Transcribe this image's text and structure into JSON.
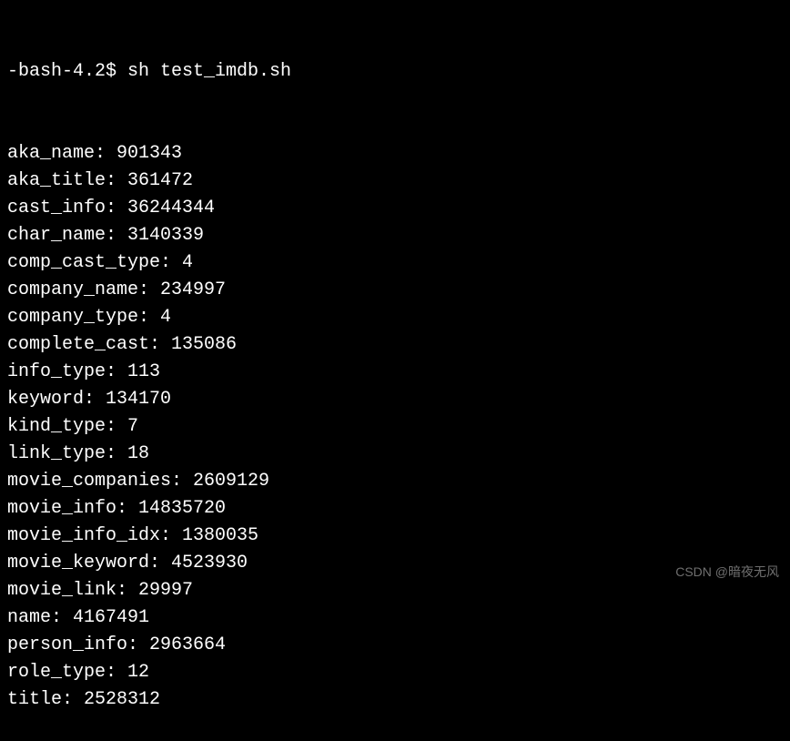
{
  "prompt": {
    "shell": "-bash-4.2$ ",
    "command": "sh test_imdb.sh"
  },
  "output_lines": [
    {
      "key": "aka_name",
      "value": "901343"
    },
    {
      "key": "aka_title",
      "value": "361472"
    },
    {
      "key": "cast_info",
      "value": "36244344"
    },
    {
      "key": "char_name",
      "value": "3140339"
    },
    {
      "key": "comp_cast_type",
      "value": "4"
    },
    {
      "key": "company_name",
      "value": "234997"
    },
    {
      "key": "company_type",
      "value": "4"
    },
    {
      "key": "complete_cast",
      "value": "135086"
    },
    {
      "key": "info_type",
      "value": "113"
    },
    {
      "key": "keyword",
      "value": "134170"
    },
    {
      "key": "kind_type",
      "value": "7"
    },
    {
      "key": "link_type",
      "value": "18"
    },
    {
      "key": "movie_companies",
      "value": "2609129"
    },
    {
      "key": "movie_info",
      "value": "14835720"
    },
    {
      "key": "movie_info_idx",
      "value": "1380035"
    },
    {
      "key": "movie_keyword",
      "value": "4523930"
    },
    {
      "key": "movie_link",
      "value": "29997"
    },
    {
      "key": "name",
      "value": "4167491"
    },
    {
      "key": "person_info",
      "value": "2963664"
    },
    {
      "key": "role_type",
      "value": "12"
    },
    {
      "key": "title",
      "value": "2528312"
    }
  ],
  "watermark": "CSDN @暗夜无风"
}
